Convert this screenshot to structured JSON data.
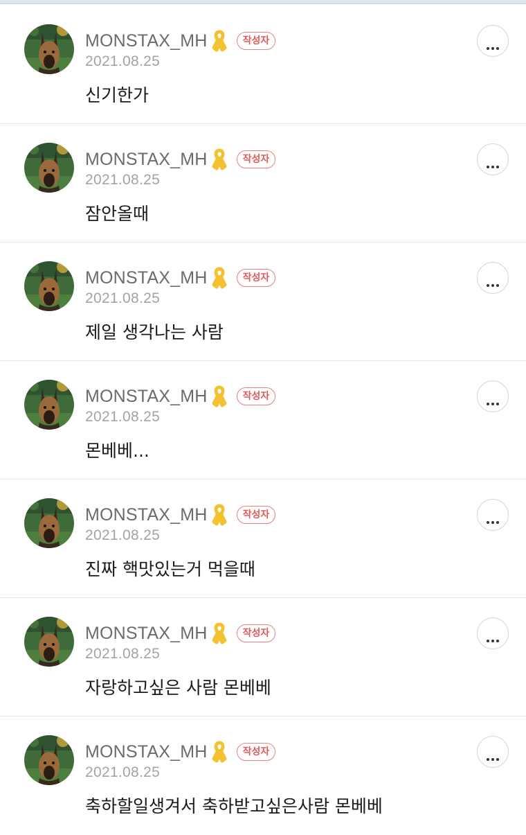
{
  "comments": [
    {
      "author": "MONSTAX_MH",
      "badge": "작성자",
      "date": "2021.08.25",
      "text": "신기한가"
    },
    {
      "author": "MONSTAX_MH",
      "badge": "작성자",
      "date": "2021.08.25",
      "text": "잠안올때"
    },
    {
      "author": "MONSTAX_MH",
      "badge": "작성자",
      "date": "2021.08.25",
      "text": "제일 생각나는 사람"
    },
    {
      "author": "MONSTAX_MH",
      "badge": "작성자",
      "date": "2021.08.25",
      "text": "몬베베..."
    },
    {
      "author": "MONSTAX_MH",
      "badge": "작성자",
      "date": "2021.08.25",
      "text": "진짜 핵맛있는거 먹을때"
    },
    {
      "author": "MONSTAX_MH",
      "badge": "작성자",
      "date": "2021.08.25",
      "text": "자랑하고싶은 사람 몬베베"
    },
    {
      "author": "MONSTAX_MH",
      "badge": "작성자",
      "date": "2021.08.25",
      "text": "축하할일생겨서 축하받고싶은사람 몬베베"
    }
  ],
  "icons": {
    "ribbon": "yellow-ribbon-icon",
    "more": "more-options-icon",
    "avatar": "dog-avatar"
  },
  "colors": {
    "badge": "#e05a5a",
    "ribbon": "#f2c230",
    "name": "#6b6b6b",
    "date": "#a3a3a3"
  }
}
